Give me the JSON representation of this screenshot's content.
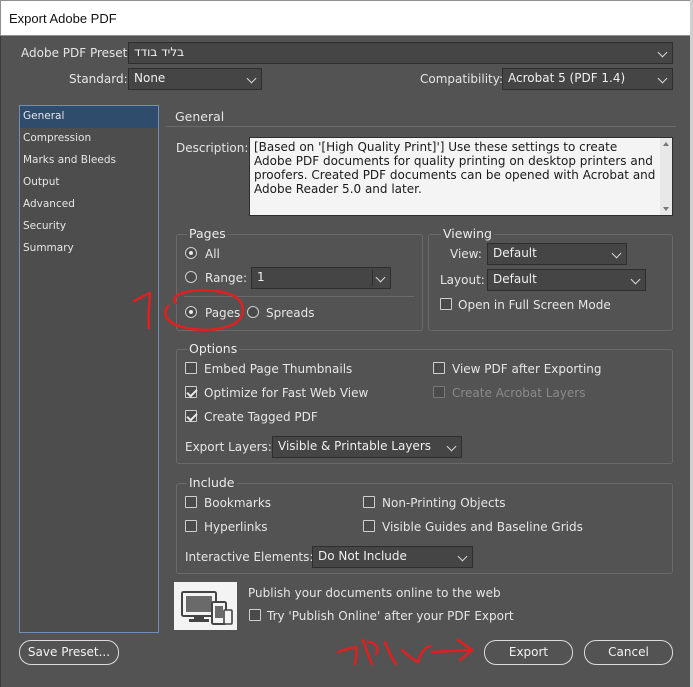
{
  "window": {
    "title": "Export Adobe PDF"
  },
  "preset": {
    "label": "Adobe PDF Preset:",
    "value": "בליד בודד"
  },
  "standard": {
    "label": "Standard:",
    "value": "None"
  },
  "compatibility": {
    "label": "Compatibility:",
    "value": "Acrobat 5 (PDF 1.4)"
  },
  "sidebar": {
    "items": [
      {
        "label": "General",
        "selected": true
      },
      {
        "label": "Compression"
      },
      {
        "label": "Marks and Bleeds"
      },
      {
        "label": "Output"
      },
      {
        "label": "Advanced"
      },
      {
        "label": "Security"
      },
      {
        "label": "Summary"
      }
    ]
  },
  "main": {
    "heading": "General",
    "description_label": "Description:",
    "description_text": "[Based on '[High Quality Print]'] Use these settings to create Adobe PDF documents for quality printing on desktop printers and proofers. Created PDF documents can be opened with Acrobat and Adobe Reader 5.0 and later."
  },
  "pages": {
    "title": "Pages",
    "all_label": "All",
    "range_label": "Range:",
    "range_value": "1",
    "pages_label": "Pages",
    "spreads_label": "Spreads"
  },
  "viewing": {
    "title": "Viewing",
    "view_label": "View:",
    "view_value": "Default",
    "layout_label": "Layout:",
    "layout_value": "Default",
    "fullscreen_label": "Open in Full Screen Mode"
  },
  "options": {
    "title": "Options",
    "embed_thumbnails": "Embed Page Thumbnails",
    "optimize_web": "Optimize for Fast Web View",
    "tagged_pdf": "Create Tagged PDF",
    "view_after": "View PDF after Exporting",
    "acrobat_layers": "Create Acrobat Layers",
    "export_layers_label": "Export Layers:",
    "export_layers_value": "Visible & Printable Layers"
  },
  "include": {
    "title": "Include",
    "bookmarks": "Bookmarks",
    "hyperlinks": "Hyperlinks",
    "non_printing": "Non-Printing Objects",
    "guides_grids": "Visible Guides and Baseline Grids",
    "interactive_label": "Interactive Elements:",
    "interactive_value": "Do Not Include"
  },
  "publish": {
    "text": "Publish your documents online to the web",
    "try_label": "Try 'Publish Online' after your PDF Export",
    "icon": "publish-online-icon"
  },
  "buttons": {
    "save_preset": "Save Preset...",
    "export": "Export",
    "cancel": "Cancel"
  },
  "colors": {
    "panel_bg": "#535353",
    "selection": "#2f4c6c",
    "annotation": "#e02020"
  }
}
